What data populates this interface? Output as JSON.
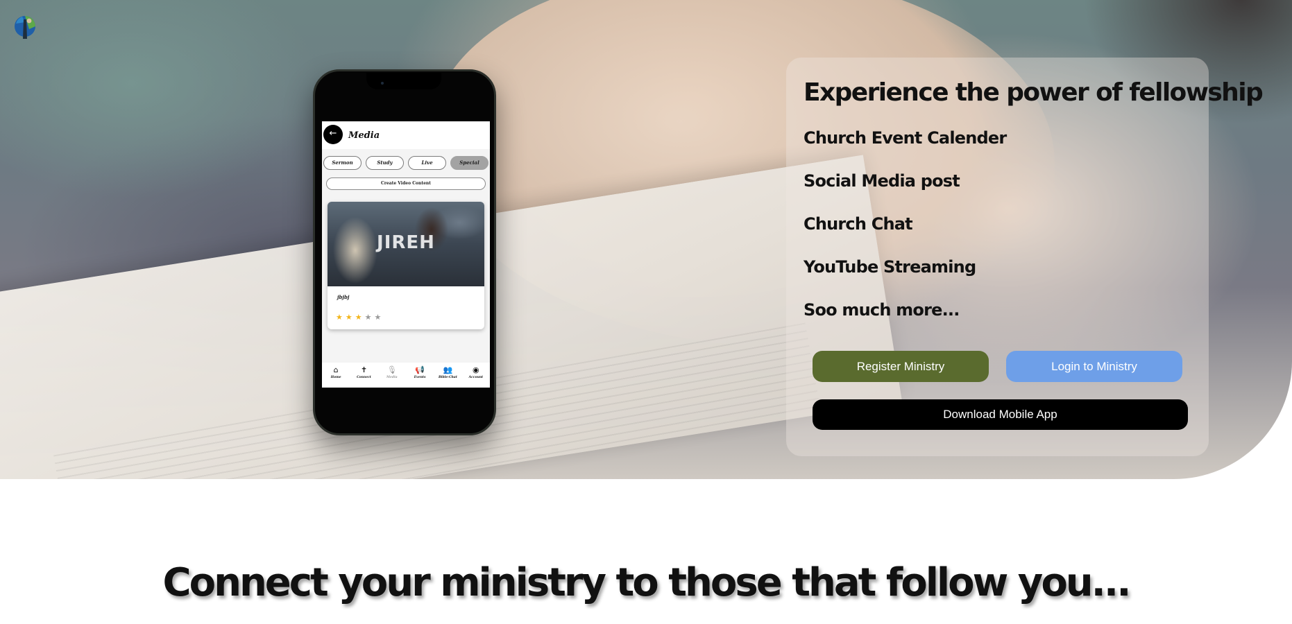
{
  "hero": {
    "heading": "Experience the power of fellowship",
    "features": [
      "Church Event Calender",
      "Social Media post",
      "Church Chat",
      "YouTube Streaming",
      "Soo much more..."
    ],
    "buttons": {
      "register": "Register Ministry",
      "login": "Login to Ministry",
      "download": "Download Mobile App"
    }
  },
  "phone": {
    "screen_title": "Media",
    "back_icon": "←",
    "tabs": [
      {
        "label": "Sermon",
        "active": false
      },
      {
        "label": "Study",
        "active": false
      },
      {
        "label": "Live",
        "active": false
      },
      {
        "label": "Special",
        "active": true
      }
    ],
    "create_button": "Create Video Content",
    "card": {
      "image_text": "JIREH",
      "name": "jbjbj",
      "rating": 3,
      "rating_max": 5
    },
    "nav": [
      {
        "icon": "home-icon",
        "glyph": "⌂",
        "label": "Home"
      },
      {
        "icon": "cross-icon",
        "glyph": "✝",
        "label": "Connect"
      },
      {
        "icon": "mic-icon",
        "glyph": "🎙",
        "label": "Media"
      },
      {
        "icon": "megaphone-icon",
        "glyph": "📢",
        "label": "Events"
      },
      {
        "icon": "bible-chat-icon",
        "glyph": "👥",
        "label": "Bible-Chat"
      },
      {
        "icon": "account-icon",
        "glyph": "◉",
        "label": "Account"
      }
    ]
  },
  "section": {
    "heading": "Connect your ministry to those that follow you..."
  },
  "colors": {
    "register": "#5a6b2e",
    "login": "#6e9fe8",
    "download": "#000000",
    "star": "#f2b51c"
  }
}
